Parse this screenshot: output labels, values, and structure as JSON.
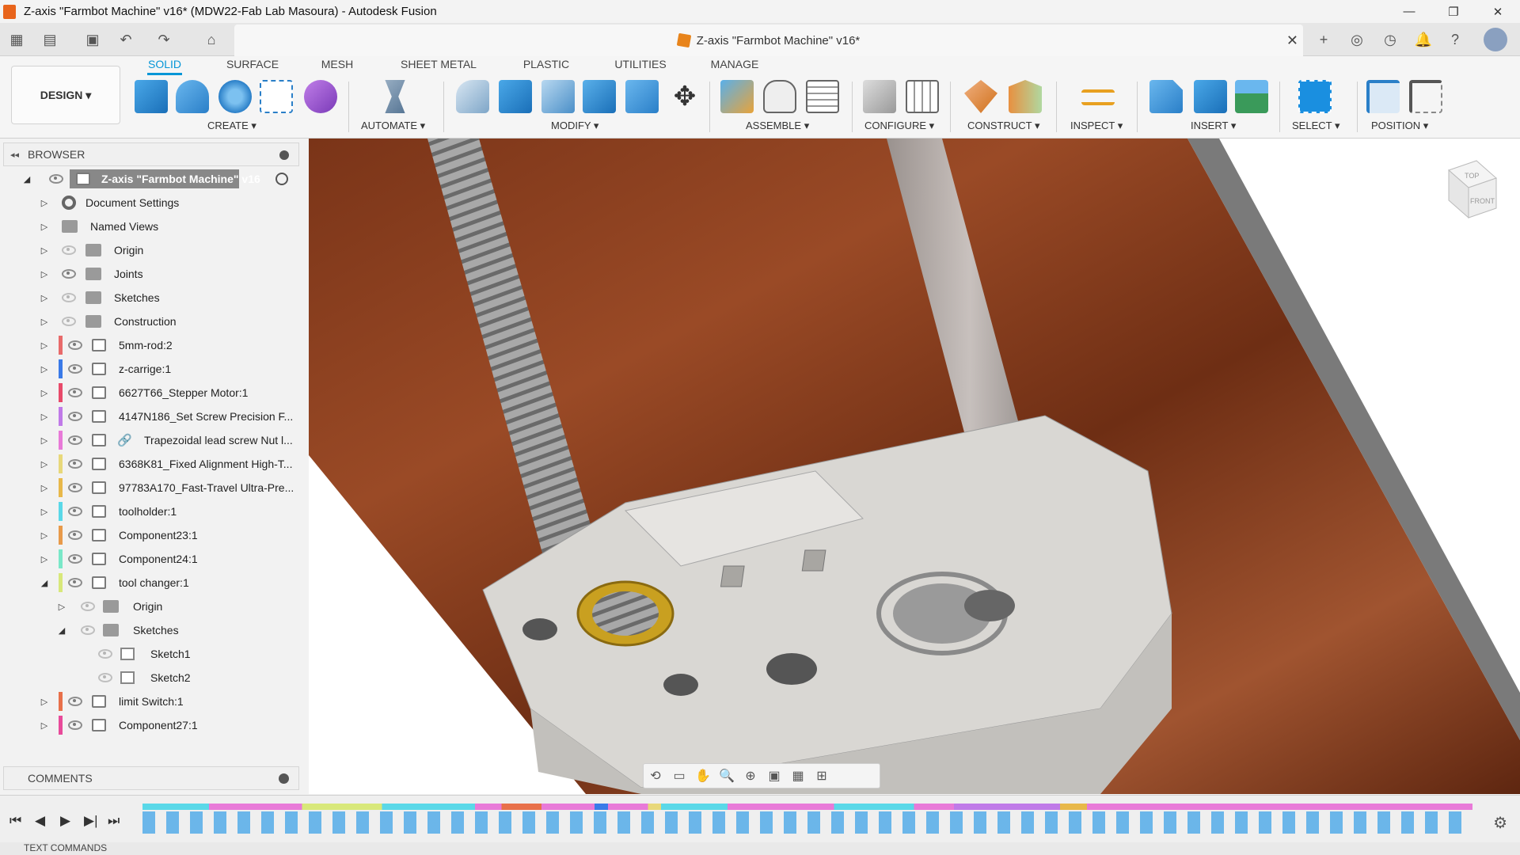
{
  "window": {
    "title": "Z-axis \"Farmbot Machine\" v16* (MDW22-Fab Lab Masoura) - Autodesk Fusion",
    "controls": [
      "—",
      "❐",
      "✕"
    ]
  },
  "document_tab": {
    "label": "Z-axis \"Farmbot Machine\" v16*",
    "close": "✕"
  },
  "ribbon": {
    "workspace": "DESIGN ▾",
    "tabs": [
      "SOLID",
      "SURFACE",
      "MESH",
      "SHEET METAL",
      "PLASTIC",
      "UTILITIES",
      "MANAGE"
    ],
    "active_tab": "SOLID",
    "groups": [
      "CREATE ▾",
      "AUTOMATE ▾",
      "MODIFY ▾",
      "ASSEMBLE ▾",
      "CONFIGURE ▾",
      "CONSTRUCT ▾",
      "INSPECT ▾",
      "INSERT ▾",
      "SELECT ▾",
      "POSITION ▾"
    ]
  },
  "browser": {
    "title": "BROWSER",
    "root": "Z-axis \"Farmbot Machine\" v16",
    "items": [
      {
        "label": "Document Settings"
      },
      {
        "label": "Named Views"
      },
      {
        "label": "Origin"
      },
      {
        "label": "Joints"
      },
      {
        "label": "Sketches"
      },
      {
        "label": "Construction"
      },
      {
        "label": "5mm-rod:2"
      },
      {
        "label": "z-carrige:1"
      },
      {
        "label": "6627T66_Stepper Motor:1"
      },
      {
        "label": "4147N186_Set Screw Precision F..."
      },
      {
        "label": "Trapezoidal lead screw Nut l..."
      },
      {
        "label": "6368K81_Fixed Alignment High-T..."
      },
      {
        "label": "97783A170_Fast-Travel Ultra-Pre..."
      },
      {
        "label": "toolholder:1"
      },
      {
        "label": "Component23:1"
      },
      {
        "label": "Component24:1"
      },
      {
        "label": "tool changer:1"
      },
      {
        "label": "Origin"
      },
      {
        "label": "Sketches"
      },
      {
        "label": "Sketch1"
      },
      {
        "label": "Sketch2"
      },
      {
        "label": "limit Switch:1"
      },
      {
        "label": "Component27:1"
      }
    ]
  },
  "comments": {
    "title": "COMMENTS"
  },
  "viewcube": {
    "top": "TOP",
    "front": "FRONT"
  },
  "textcommands": {
    "label": "TEXT COMMANDS"
  },
  "colors": {
    "accent": "#0696d7",
    "wood": "#8a3f20",
    "part": "#d9d7d3"
  }
}
